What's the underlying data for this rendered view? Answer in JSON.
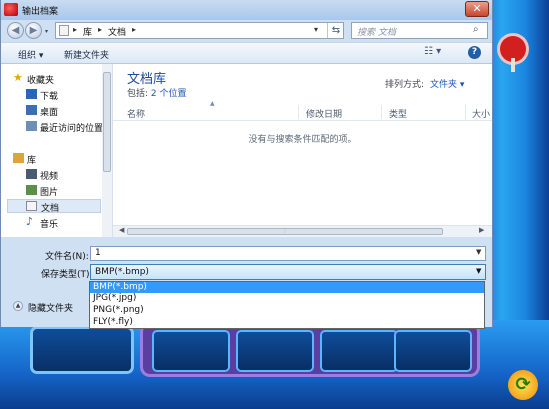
{
  "window": {
    "title": "输出档案",
    "close_glyph": "✕"
  },
  "nav": {
    "back_glyph": "◀",
    "forward_glyph": "▶",
    "address": {
      "crumbs": [
        "库",
        "文档"
      ],
      "separator": "▸",
      "dropdown_glyph": "▾",
      "refresh_glyph": "⇆"
    },
    "search": {
      "placeholder": "搜索 文档",
      "icon": "search-icon",
      "glyph": "⌕"
    }
  },
  "toolbar": {
    "organize_label": "组织 ▾",
    "new_folder_label": "新建文件夹",
    "view_glyph": "☷ ▾",
    "help_glyph": "?"
  },
  "sidebar": {
    "items": [
      {
        "label": "收藏夹",
        "icon": "star-icon",
        "level": 0
      },
      {
        "label": "下载",
        "icon": "download-folder-icon",
        "level": 1
      },
      {
        "label": "桌面",
        "icon": "desktop-icon",
        "level": 1
      },
      {
        "label": "最近访问的位置",
        "icon": "recent-places-icon",
        "level": 1
      },
      {
        "label": "库",
        "icon": "library-icon",
        "level": 0
      },
      {
        "label": "视频",
        "icon": "video-library-icon",
        "level": 1
      },
      {
        "label": "图片",
        "icon": "picture-library-icon",
        "level": 1
      },
      {
        "label": "文档",
        "icon": "document-library-icon",
        "level": 1,
        "selected": true
      },
      {
        "label": "音乐",
        "icon": "music-library-icon",
        "level": 1
      }
    ]
  },
  "content": {
    "library_title": "文档库",
    "includes_prefix": "包括:",
    "includes_link": "2 个位置",
    "arrange_label": "排列方式:",
    "arrange_value": "文件夹 ▾",
    "columns": [
      "名称",
      "修改日期",
      "类型",
      "大小"
    ],
    "empty_message": "没有与搜索条件匹配的项。"
  },
  "form": {
    "filename_label": "文件名(N):",
    "filename_value": "1",
    "filetype_label": "保存类型(T):",
    "filetype_value": "BMP(*.bmp)",
    "filetype_options": [
      "BMP(*.bmp)",
      "JPG(*.jpg)",
      "PNG(*.png)",
      "FLY(*.fly)"
    ],
    "hide_folders_label": "隐藏文件夹",
    "dropdown_glyph": "▼"
  },
  "colors": {
    "accent": "#3399ff",
    "title_blue": "#1e4a9c",
    "link_blue": "#1a56b4"
  }
}
